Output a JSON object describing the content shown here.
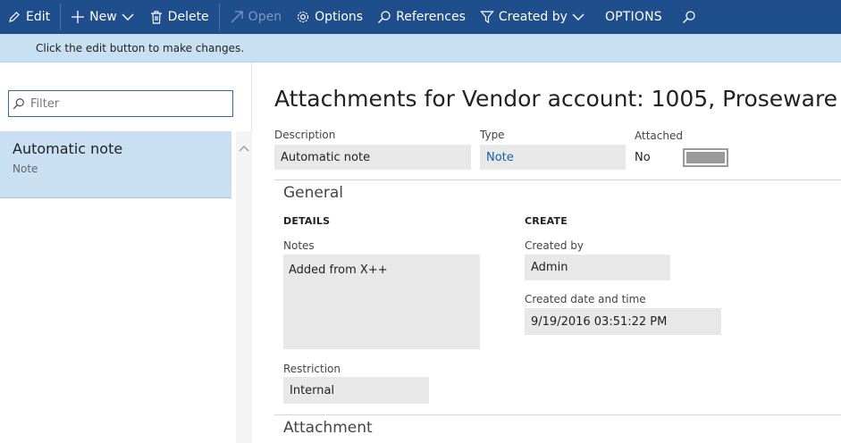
{
  "toolbar": {
    "edit": "Edit",
    "new": "New",
    "delete": "Delete",
    "open": "Open",
    "options": "Options",
    "references": "References",
    "created_by": "Created by",
    "options_caps": "OPTIONS"
  },
  "infobar": {
    "message": "Click the edit button to make changes."
  },
  "filter": {
    "placeholder": "Filter",
    "value": ""
  },
  "list": {
    "items": [
      {
        "title": "Automatic note",
        "subtitle": "Note"
      }
    ]
  },
  "main": {
    "title": "Attachments for Vendor account: 1005, Proseware",
    "description_label": "Description",
    "description_value": "Automatic note",
    "type_label": "Type",
    "type_value": "Note",
    "attached_label": "Attached",
    "attached_value": "No",
    "general_title": "General",
    "details_header": "DETAILS",
    "notes_label": "Notes",
    "notes_value": "Added from X++",
    "restriction_label": "Restriction",
    "restriction_value": "Internal",
    "create_header": "CREATE",
    "created_by_label": "Created by",
    "created_by_value": "Admin",
    "created_dt_label": "Created date and time",
    "created_dt_value": "9/19/2016 03:51:22 PM",
    "attachment_title": "Attachment"
  },
  "colors": {
    "toolbar_bg": "#1f4e8c",
    "infobar_bg": "#c9dff2",
    "selected_item_bg": "#c9dff2",
    "field_bg": "#e8e8e8",
    "link": "#1a5fa8"
  },
  "icons": [
    "pencil-icon",
    "plus-icon",
    "chevron-down-icon",
    "trash-icon",
    "open-arrow-icon",
    "gear-icon",
    "search-icon",
    "funnel-icon",
    "chevron-up-icon"
  ]
}
